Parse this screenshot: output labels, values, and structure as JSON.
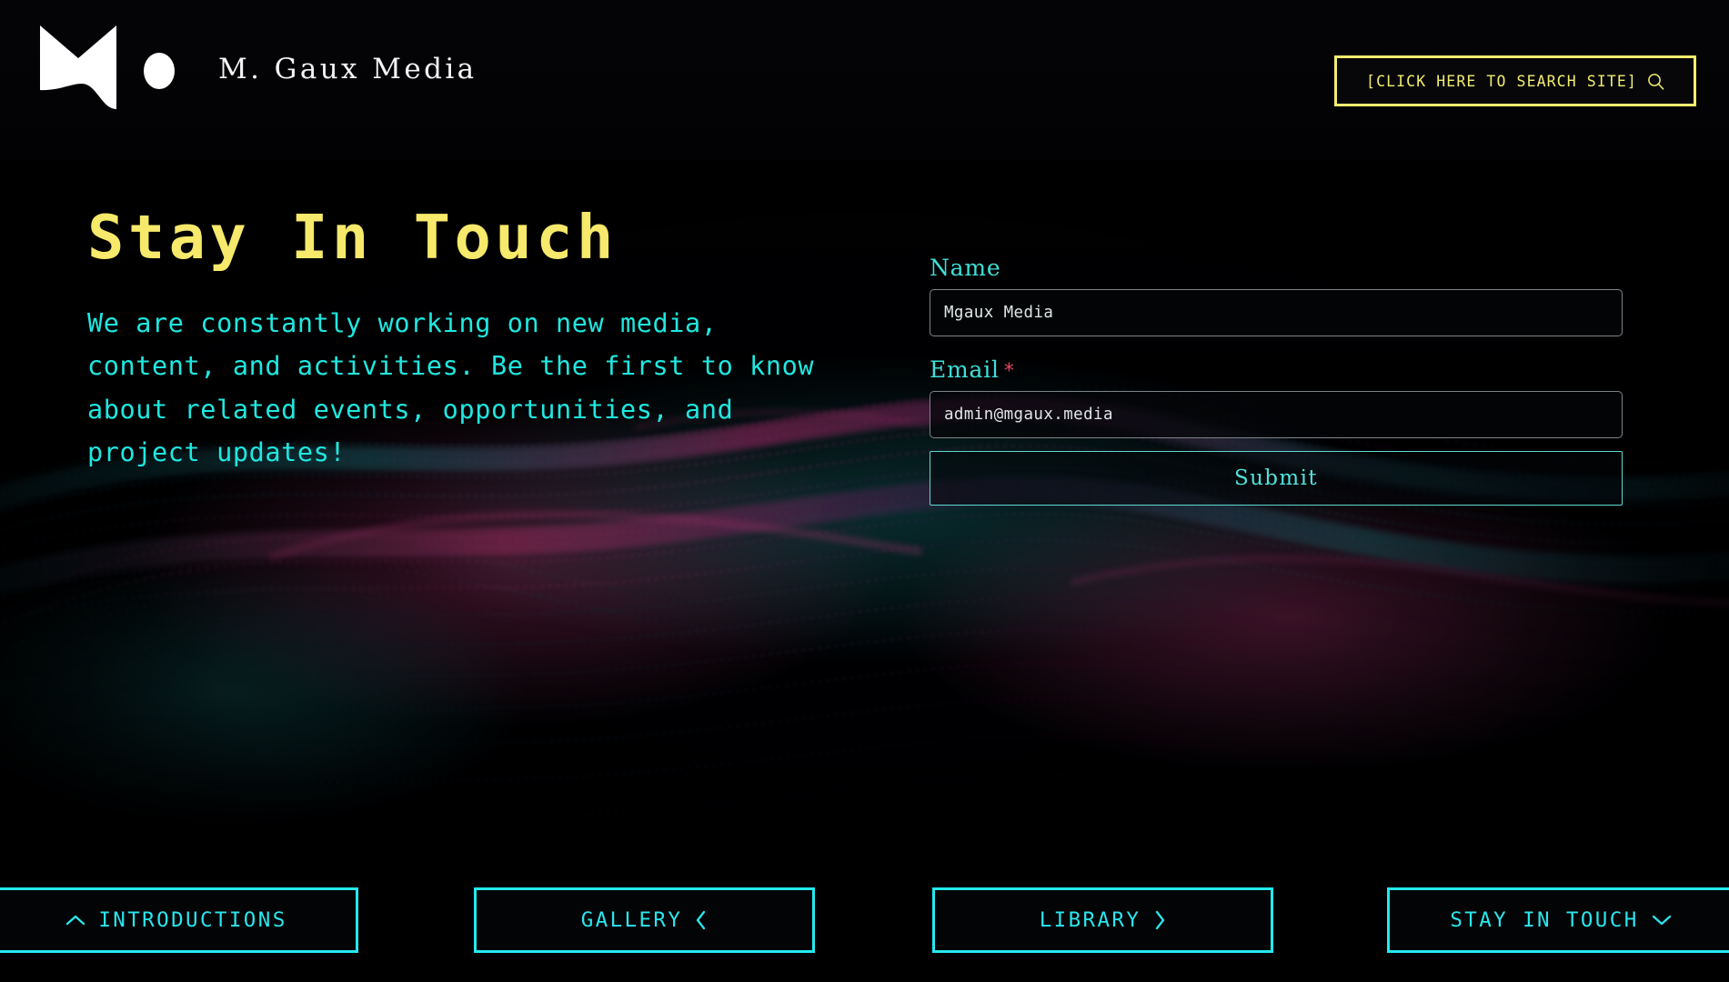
{
  "header": {
    "brand_title": "M. Gaux Media",
    "logo_icon": "mgaux-m-logo-icon",
    "search": {
      "label": "[CLICK HERE TO SEARCH SITE]",
      "icon": "search-icon"
    }
  },
  "main": {
    "title": "Stay In Touch",
    "paragraph": "We are constantly working on new media, content, and activities. Be the first to know about related events, opportunities, and project updates!"
  },
  "form": {
    "name_label": "Name",
    "name_value": "Mgaux Media",
    "name_placeholder": "Name",
    "email_label": "Email",
    "email_required_mark": "*",
    "email_value": "admin@mgaux.media",
    "email_placeholder": "Email",
    "submit_label": "Submit"
  },
  "bottom_nav": [
    {
      "label": "INTRODUCTIONS",
      "icon": "chevron-up-icon",
      "icon_side": "left"
    },
    {
      "label": "GALLERY",
      "icon": "chevron-left-icon",
      "icon_side": "right"
    },
    {
      "label": "LIBRARY",
      "icon": "chevron-right-icon",
      "icon_side": "right"
    },
    {
      "label": "STAY IN TOUCH",
      "icon": "chevron-down-icon",
      "icon_side": "right"
    }
  ],
  "colors": {
    "background": "#010102",
    "accent_yellow": "#f6e96b",
    "accent_cyan": "#25e8ef",
    "body_cyan": "#1fe8e0",
    "label_cyan": "#3fe0d8",
    "required_red": "#e44463",
    "input_text": "#dfe7e6",
    "input_border": "#7d8488",
    "brand_white": "#f3f4f6",
    "wave_magenta": "#b0306e",
    "wave_teal": "#1d6f78"
  }
}
